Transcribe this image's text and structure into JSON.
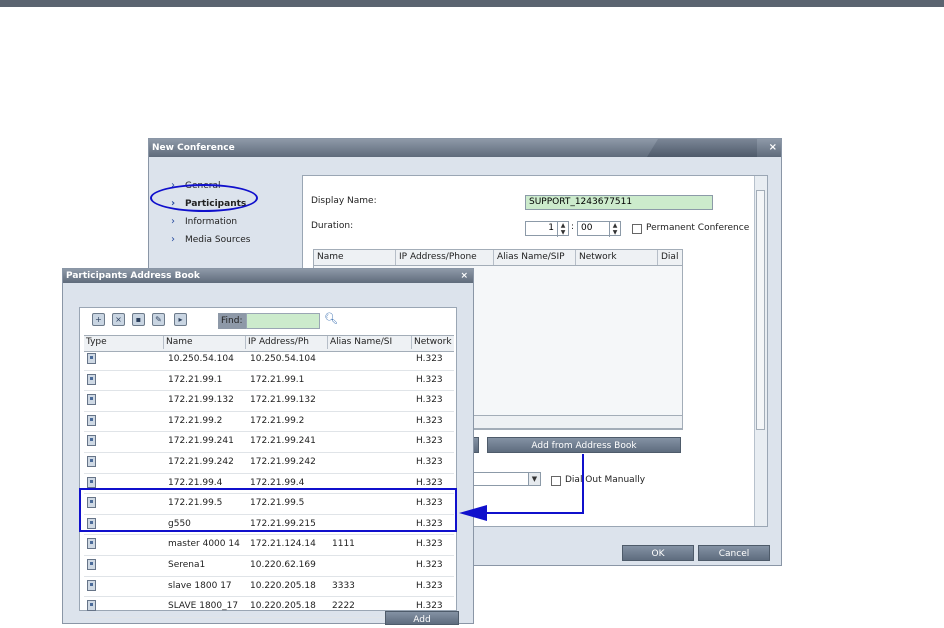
{
  "new_conference": {
    "title": "New Conference",
    "close": "×",
    "nav": [
      "General",
      "Participants",
      "Information",
      "Media Sources"
    ],
    "display_name_label": "Display Name:",
    "display_name_value": "SUPPORT_1243677511",
    "duration_label": "Duration:",
    "duration_hours": "1",
    "duration_minutes": "00",
    "duration_sep": ":",
    "permanent_label": "Permanent Conference",
    "grid_headers": [
      "Name",
      "IP Address/Phone",
      "Alias Name/SIP",
      "Network",
      "Dial"
    ],
    "add_from_address_book": "Add from Address Book",
    "dial_out_label": "Dial Out Manually",
    "ok": "OK",
    "cancel": "Cancel"
  },
  "address_book": {
    "title": "Participants Address Book",
    "close": "×",
    "find_label": "Find:",
    "headers": [
      "Type",
      "Name",
      "IP Address/Ph",
      "Alias Name/SI",
      "Network"
    ],
    "add": "Add",
    "rows": [
      {
        "name": "10.250.54.104",
        "ip": "10.250.54.104",
        "alias": "",
        "network": "H.323"
      },
      {
        "name": "172.21.99.1",
        "ip": "172.21.99.1",
        "alias": "",
        "network": "H.323"
      },
      {
        "name": "172.21.99.132",
        "ip": "172.21.99.132",
        "alias": "",
        "network": "H.323"
      },
      {
        "name": "172.21.99.2",
        "ip": "172.21.99.2",
        "alias": "",
        "network": "H.323"
      },
      {
        "name": "172.21.99.241",
        "ip": "172.21.99.241",
        "alias": "",
        "network": "H.323"
      },
      {
        "name": "172.21.99.242",
        "ip": "172.21.99.242",
        "alias": "",
        "network": "H.323"
      },
      {
        "name": "172.21.99.4",
        "ip": "172.21.99.4",
        "alias": "",
        "network": "H.323"
      },
      {
        "name": "172.21.99.5",
        "ip": "172.21.99.5",
        "alias": "",
        "network": "H.323"
      },
      {
        "name": "g550",
        "ip": "172.21.99.215",
        "alias": "",
        "network": "H.323"
      },
      {
        "name": "master 4000 14",
        "ip": "172.21.124.14",
        "alias": "1111",
        "network": "H.323"
      },
      {
        "name": "Serena1",
        "ip": "10.220.62.169",
        "alias": "",
        "network": "H.323"
      },
      {
        "name": "slave 1800 17",
        "ip": "10.220.205.18",
        "alias": "3333",
        "network": "H.323"
      },
      {
        "name": "SLAVE 1800_17",
        "ip": "10.220.205.18",
        "alias": "2222",
        "network": "H.323"
      }
    ]
  },
  "colors": {
    "annotation": "#1010cc",
    "title_bar": "#6b7686",
    "find_field": "#ccebcc"
  }
}
